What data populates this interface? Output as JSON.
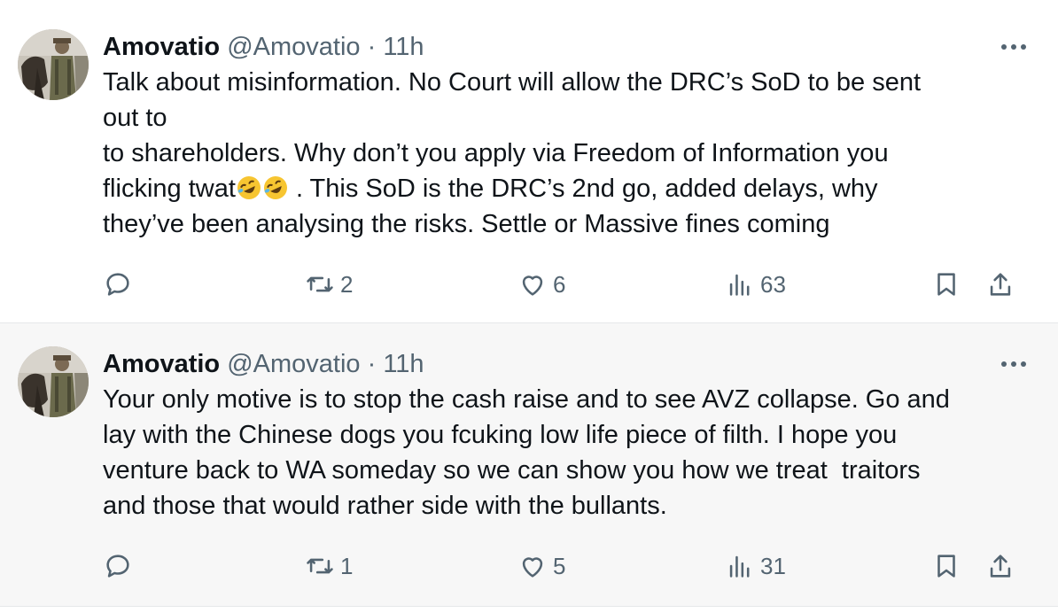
{
  "tweets": [
    {
      "display_name": "Amovatio",
      "handle": "@Amovatio",
      "separator": "·",
      "time": "11h",
      "lines": [
        "Talk about misinformation. No Court will allow the DRC’s SoD to be sent",
        "out to",
        "to shareholders. Why don’t you apply via Freedom of Information you",
        "flicking twat",
        " . This SoD is the DRC’s 2nd go, added delays, why",
        "they’ve been analysing the risks. Settle or Massive fines coming"
      ],
      "emoji": "rolling-on-floor-laughing-emoji",
      "stats": {
        "replies": "",
        "reposts": "2",
        "likes": "6",
        "views": "63"
      }
    },
    {
      "display_name": "Amovatio",
      "handle": "@Amovatio",
      "separator": "·",
      "time": "11h",
      "lines": [
        "Your only motive is to stop the cash raise and to see AVZ collapse. Go and",
        "lay with the Chinese dogs you fcuking low life piece of filth. I hope you",
        "venture back to WA someday so we can show you how we treat  traitors",
        "and those that would rather side with the bullants."
      ],
      "stats": {
        "replies": "",
        "reposts": "1",
        "likes": "5",
        "views": "31"
      }
    }
  ],
  "colors": {
    "text": "#0f1419",
    "secondary": "#536471",
    "highlight_background": "#f7f7f7",
    "border": "#e6e8ea"
  },
  "icons": [
    "more-icon",
    "reply-icon",
    "repost-icon",
    "like-icon",
    "views-icon",
    "bookmark-icon",
    "share-icon"
  ]
}
